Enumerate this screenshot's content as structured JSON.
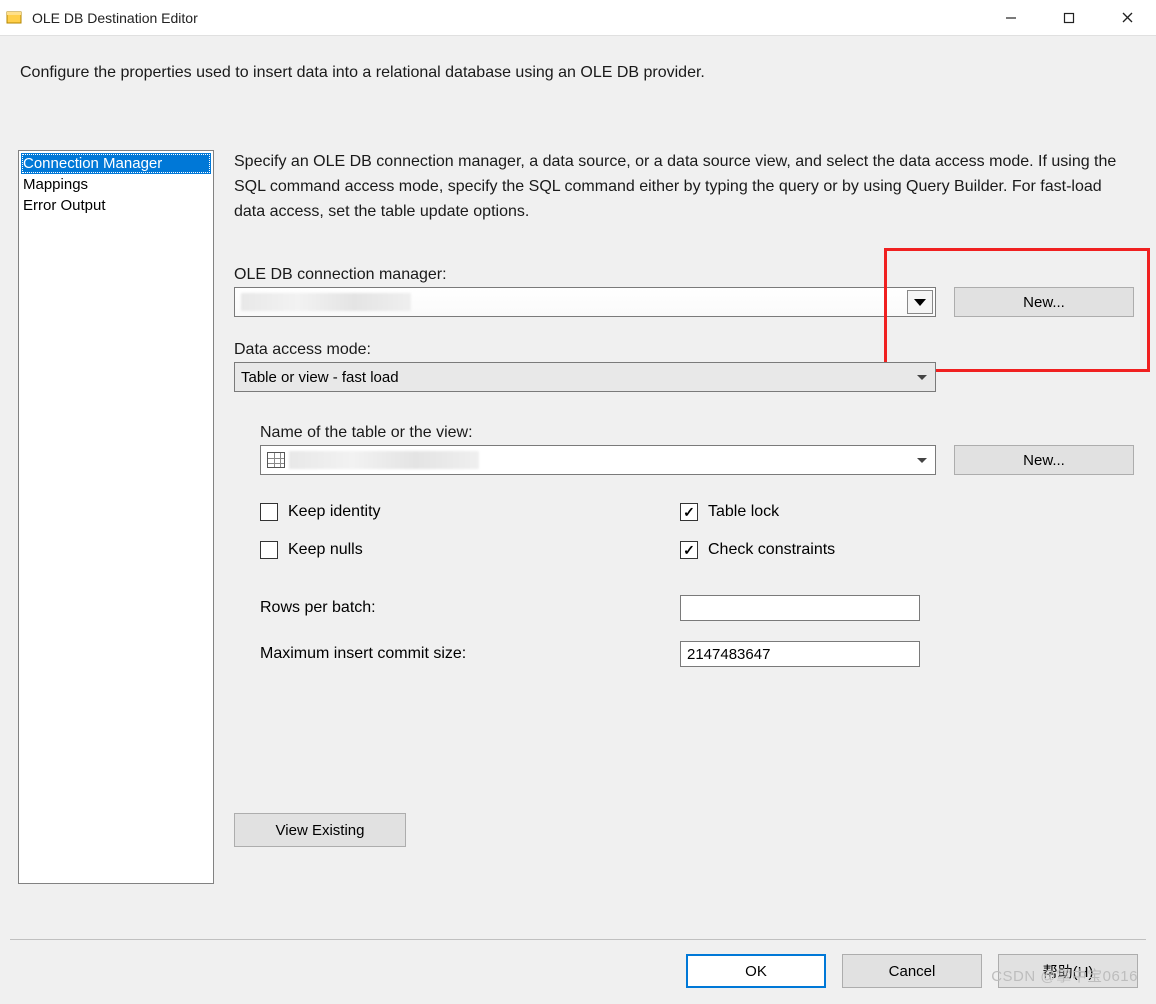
{
  "window": {
    "title": "OLE DB Destination Editor"
  },
  "topDescription": "Configure the properties used to insert data into a relational database using an OLE DB provider.",
  "sidebar": {
    "items": [
      {
        "label": "Connection Manager",
        "selected": true
      },
      {
        "label": "Mappings",
        "selected": false
      },
      {
        "label": "Error Output",
        "selected": false
      }
    ]
  },
  "content": {
    "description": "Specify an OLE DB connection manager, a data source, or a data source view, and select the data access mode. If using the SQL command access mode, specify the SQL command either by typing the query or by using Query Builder. For fast-load data access, set the table update options.",
    "connection": {
      "label": "OLE DB connection manager:",
      "value": "",
      "newButton": "New..."
    },
    "accessMode": {
      "label": "Data access mode:",
      "value": "Table or view - fast load"
    },
    "tableName": {
      "label": "Name of the table or the view:",
      "value": "",
      "newButton": "New..."
    },
    "options": {
      "keepIdentity": {
        "label": "Keep identity",
        "checked": false
      },
      "keepNulls": {
        "label": "Keep nulls",
        "checked": false
      },
      "tableLock": {
        "label": "Table lock",
        "checked": true
      },
      "checkConstraints": {
        "label": "Check constraints",
        "checked": true
      }
    },
    "rowsPerBatch": {
      "label": "Rows per batch:",
      "value": ""
    },
    "maxCommit": {
      "label": "Maximum insert commit size:",
      "value": "2147483647"
    },
    "viewExisting": "View Existing"
  },
  "footer": {
    "ok": "OK",
    "cancel": "Cancel",
    "help": "帮助(H)"
  },
  "watermark": "CSDN @掌中宝0616"
}
